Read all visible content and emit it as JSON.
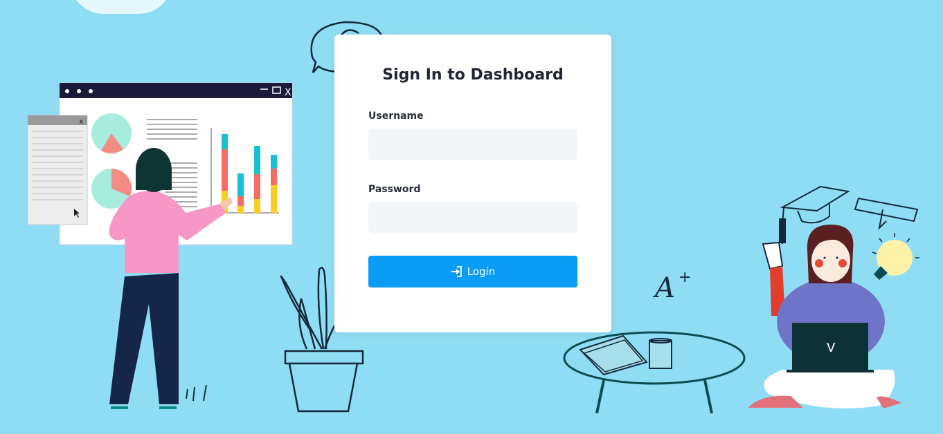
{
  "login": {
    "title": "Sign In to Dashboard",
    "username_label": "Username",
    "username_value": "",
    "password_label": "Password",
    "password_value": "",
    "button_label": "Login",
    "button_icon": "sign-in-icon"
  },
  "illustrations": {
    "window_close_glyph": "X",
    "popup_close_glyph": "x",
    "grade_text": "A",
    "grade_sup": "+",
    "laptop_logo": "V"
  },
  "colors": {
    "background": "#8fddf4",
    "accent": "#0b9df5",
    "card": "#ffffff",
    "input_bg": "#f3f6f9"
  }
}
